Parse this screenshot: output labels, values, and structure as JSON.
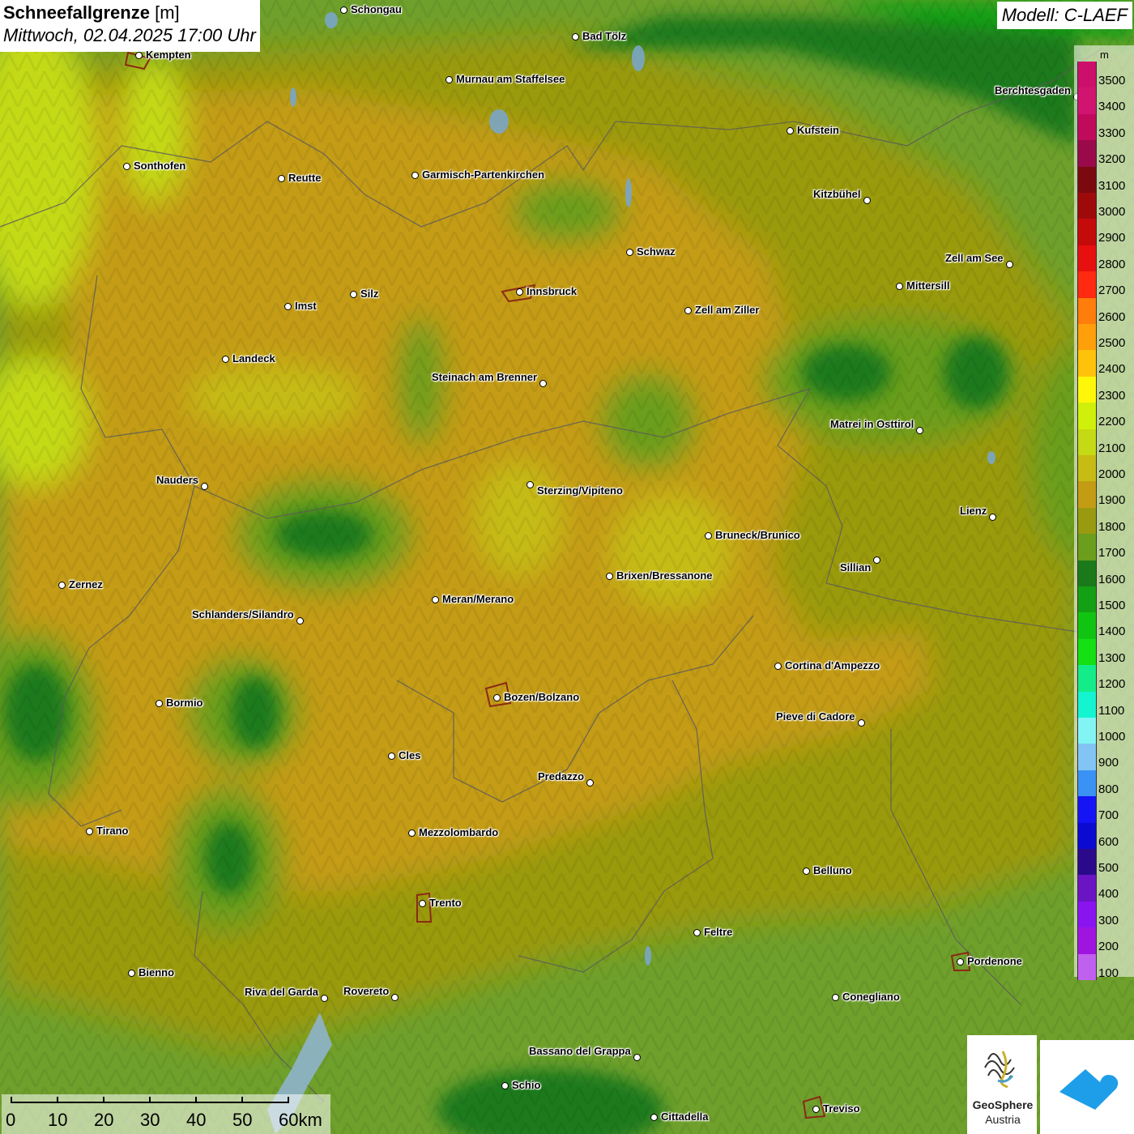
{
  "title": {
    "parameter": "Schneefallgrenze",
    "unit": "[m]",
    "datetime": "Mittwoch, 02.04.2025 17:00 Uhr"
  },
  "model": "Modell: C-LAEF",
  "legend": {
    "unit": "m",
    "entries": [
      {
        "label": "3500",
        "color": "#cc0f6a"
      },
      {
        "label": "3400",
        "color": "#d11470"
      },
      {
        "label": "3300",
        "color": "#c00a5c"
      },
      {
        "label": "3200",
        "color": "#9a0a4a"
      },
      {
        "label": "3100",
        "color": "#7a0a10"
      },
      {
        "label": "3000",
        "color": "#9e0a0a"
      },
      {
        "label": "2900",
        "color": "#c50a0a"
      },
      {
        "label": "2800",
        "color": "#e80f0f"
      },
      {
        "label": "2700",
        "color": "#ff2a10"
      },
      {
        "label": "2600",
        "color": "#ff7d0a"
      },
      {
        "label": "2500",
        "color": "#ff9f0a"
      },
      {
        "label": "2400",
        "color": "#ffc20a"
      },
      {
        "label": "2300",
        "color": "#fff70a"
      },
      {
        "label": "2200",
        "color": "#cff00a"
      },
      {
        "label": "2100",
        "color": "#c4da14"
      },
      {
        "label": "2000",
        "color": "#c6bc14"
      },
      {
        "label": "1900",
        "color": "#c49c14"
      },
      {
        "label": "1800",
        "color": "#9a9a10"
      },
      {
        "label": "1700",
        "color": "#6a9e1c"
      },
      {
        "label": "1600",
        "color": "#1a7a1a"
      },
      {
        "label": "1500",
        "color": "#14a014"
      },
      {
        "label": "1400",
        "color": "#12c412"
      },
      {
        "label": "1300",
        "color": "#14e014"
      },
      {
        "label": "1200",
        "color": "#14ec8a"
      },
      {
        "label": "1100",
        "color": "#14f4d0"
      },
      {
        "label": "1000",
        "color": "#82f4f4"
      },
      {
        "label": "900",
        "color": "#82c4f4"
      },
      {
        "label": "800",
        "color": "#3a92f4"
      },
      {
        "label": "700",
        "color": "#1414f4"
      },
      {
        "label": "600",
        "color": "#0a0ad0"
      },
      {
        "label": "500",
        "color": "#2a0a8a"
      },
      {
        "label": "400",
        "color": "#6a14c4"
      },
      {
        "label": "300",
        "color": "#8a14f0"
      },
      {
        "label": "200",
        "color": "#a014e0"
      },
      {
        "label": "100",
        "color": "#c060ef"
      }
    ]
  },
  "cities": [
    {
      "name": "Schongau"
    },
    {
      "name": "Kempten"
    },
    {
      "name": "Bad Tölz"
    },
    {
      "name": "Murnau am Staffelsee"
    },
    {
      "name": "Berchtesgaden"
    },
    {
      "name": "Kufstein"
    },
    {
      "name": "Sonthofen"
    },
    {
      "name": "Reutte"
    },
    {
      "name": "Garmisch-Partenkirchen"
    },
    {
      "name": "Kitzbühel"
    },
    {
      "name": "Schwaz"
    },
    {
      "name": "Zell am See"
    },
    {
      "name": "Innsbruck"
    },
    {
      "name": "Mittersill"
    },
    {
      "name": "Imst"
    },
    {
      "name": "Silz"
    },
    {
      "name": "Zell am Ziller"
    },
    {
      "name": "Landeck"
    },
    {
      "name": "Steinach am Brenner"
    },
    {
      "name": "Matrei in Osttirol"
    },
    {
      "name": "Nauders"
    },
    {
      "name": "Sterzing/Vipiteno"
    },
    {
      "name": "Lienz"
    },
    {
      "name": "Bruneck/Brunico"
    },
    {
      "name": "Sillian"
    },
    {
      "name": "Zernez"
    },
    {
      "name": "Brixen/Bressanone"
    },
    {
      "name": "Meran/Merano"
    },
    {
      "name": "Schlanders/Silandro"
    },
    {
      "name": "Cortina d'Ampezzo"
    },
    {
      "name": "Bozen/Bolzano"
    },
    {
      "name": "Bormio"
    },
    {
      "name": "Pieve di Cadore"
    },
    {
      "name": "Cles"
    },
    {
      "name": "Predazzo"
    },
    {
      "name": "Tirano"
    },
    {
      "name": "Mezzolombardo"
    },
    {
      "name": "Belluno"
    },
    {
      "name": "Trento"
    },
    {
      "name": "Feltre"
    },
    {
      "name": "Pordenone"
    },
    {
      "name": "Bienno"
    },
    {
      "name": "Riva del Garda"
    },
    {
      "name": "Rovereto"
    },
    {
      "name": "Conegliano"
    },
    {
      "name": "Bassano del Grappa"
    },
    {
      "name": "Schio"
    },
    {
      "name": "Treviso"
    },
    {
      "name": "Cittadella"
    }
  ],
  "scale": {
    "labels": [
      "0",
      "10",
      "20",
      "30",
      "40",
      "50",
      "60km"
    ]
  },
  "logos": {
    "geosphere_line1": "GeoSphere",
    "geosphere_line2": "Austria"
  }
}
